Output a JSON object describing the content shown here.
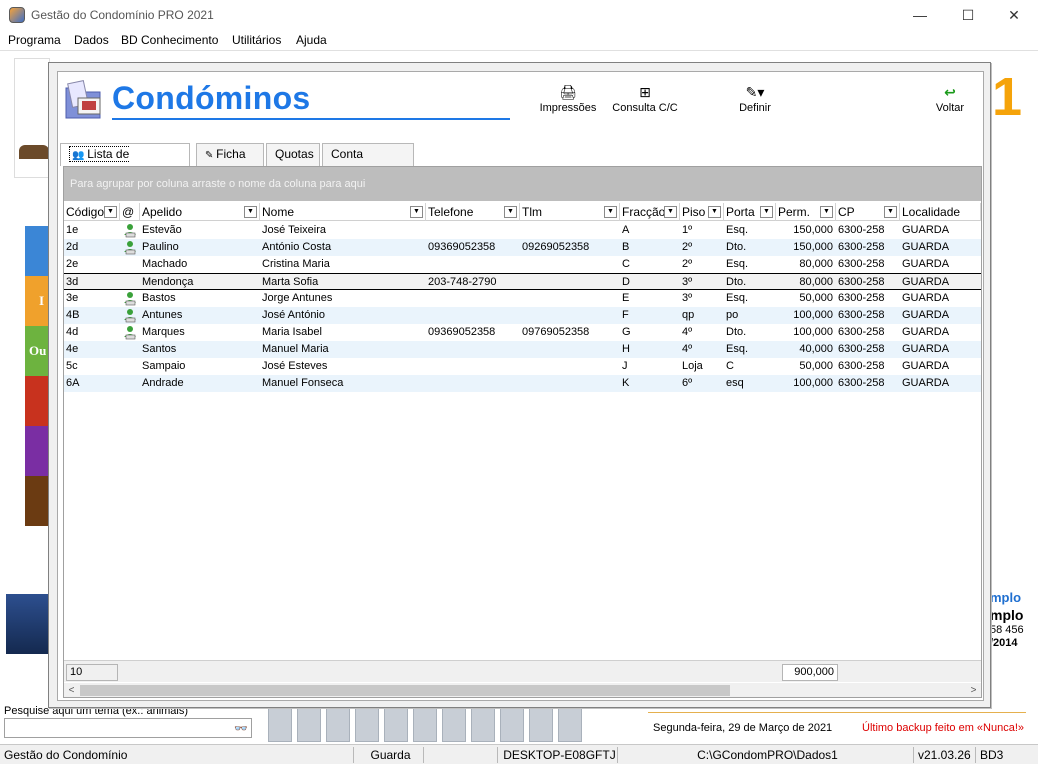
{
  "window": {
    "title": "Gestão do Condomínio PRO 2021",
    "minimize": "—",
    "maximize": "☐",
    "close": "✕"
  },
  "menu": [
    "Programa",
    "Dados",
    "BD Conhecimento",
    "Utilitários",
    "Ajuda"
  ],
  "background": {
    "big_number": "1",
    "bar_labels": [
      "I",
      "Ou"
    ],
    "right_texts": [
      "mplo",
      "mplo",
      "58 456",
      "/2014"
    ],
    "search_label": "Pesquise aqui um tema (ex.: animais)",
    "search_value": "",
    "date": "Segunda-feira, 29 de Março de 2021",
    "backup": "Último backup feito em  «Nunca!»"
  },
  "statusbar": [
    "Gestão do Condomínio",
    "Guarda",
    "DESKTOP-E08GFTJ",
    "C:\\GCondomPRO\\Dados1",
    "v21.03.26",
    "BD3"
  ],
  "module": {
    "title": "Condóminos",
    "toolbar": {
      "print": "Impressões",
      "account": "Consulta C/C",
      "define": "Definir",
      "back": "Voltar"
    },
    "tabs": [
      "Lista de Condóminos",
      "Ficha",
      "Quotas",
      "Conta Corrente"
    ],
    "group_hint": "Para agrupar por coluna arraste o nome da coluna para aqui",
    "columns": [
      "Código",
      "@",
      "Apelido",
      "Nome",
      "Telefone",
      "Tlm",
      "Fracção",
      "Piso",
      "Porta",
      "Perm.",
      "CP",
      "Localidade"
    ],
    "rows": [
      {
        "codigo": "1e",
        "email": true,
        "apelido": "Estevão",
        "nome": "José Teixeira",
        "telefone": "",
        "tlm": "",
        "fraccao": "A",
        "piso": "1º",
        "porta": "Esq.",
        "perm": "150,000",
        "cp": "6300-258",
        "localidade": "GUARDA"
      },
      {
        "codigo": "2d",
        "email": true,
        "apelido": "Paulino",
        "nome": "António Costa",
        "telefone": "09369052358",
        "tlm": "09269052358",
        "fraccao": "B",
        "piso": "2º",
        "porta": "Dto.",
        "perm": "150,000",
        "cp": "6300-258",
        "localidade": "GUARDA"
      },
      {
        "codigo": "2e",
        "email": false,
        "apelido": "Machado",
        "nome": "Cristina Maria",
        "telefone": "",
        "tlm": "",
        "fraccao": "C",
        "piso": "2º",
        "porta": "Esq.",
        "perm": "80,000",
        "cp": "6300-258",
        "localidade": "GUARDA"
      },
      {
        "codigo": "3d",
        "email": false,
        "apelido": "Mendonça",
        "nome": "Marta Sofia",
        "telefone": "203-748-2790",
        "tlm": "",
        "fraccao": "D",
        "piso": "3º",
        "porta": "Dto.",
        "perm": "80,000",
        "cp": "6300-258",
        "localidade": "GUARDA"
      },
      {
        "codigo": "3e",
        "email": true,
        "apelido": "Bastos",
        "nome": "Jorge Antunes",
        "telefone": "",
        "tlm": "",
        "fraccao": "E",
        "piso": "3º",
        "porta": "Esq.",
        "perm": "50,000",
        "cp": "6300-258",
        "localidade": "GUARDA"
      },
      {
        "codigo": "4B",
        "email": true,
        "apelido": "Antunes",
        "nome": "José António",
        "telefone": "",
        "tlm": "",
        "fraccao": "F",
        "piso": "qp",
        "porta": "po",
        "perm": "100,000",
        "cp": "6300-258",
        "localidade": "GUARDA"
      },
      {
        "codigo": "4d",
        "email": true,
        "apelido": "Marques",
        "nome": "Maria Isabel",
        "telefone": "09369052358",
        "tlm": "09769052358",
        "fraccao": "G",
        "piso": "4º",
        "porta": "Dto.",
        "perm": "100,000",
        "cp": "6300-258",
        "localidade": "GUARDA"
      },
      {
        "codigo": "4e",
        "email": false,
        "apelido": "Santos",
        "nome": "Manuel Maria",
        "telefone": "",
        "tlm": "",
        "fraccao": "H",
        "piso": "4º",
        "porta": "Esq.",
        "perm": "40,000",
        "cp": "6300-258",
        "localidade": "GUARDA"
      },
      {
        "codigo": "5c",
        "email": false,
        "apelido": "Sampaio",
        "nome": "José Esteves",
        "telefone": "",
        "tlm": "",
        "fraccao": "J",
        "piso": "Loja",
        "porta": "C",
        "perm": "50,000",
        "cp": "6300-258",
        "localidade": "GUARDA"
      },
      {
        "codigo": "6A",
        "email": false,
        "apelido": "Andrade",
        "nome": "Manuel Fonseca",
        "telefone": "",
        "tlm": "",
        "fraccao": "K",
        "piso": "6º",
        "porta": "esq",
        "perm": "100,000",
        "cp": "6300-258",
        "localidade": "GUARDA"
      }
    ],
    "selected_row": 3,
    "footer": {
      "count": "10",
      "total": "900,000"
    }
  },
  "colors": {
    "accent": "#1e78e6",
    "orange": "#f5a30a",
    "backup_red": "#dd0000"
  }
}
